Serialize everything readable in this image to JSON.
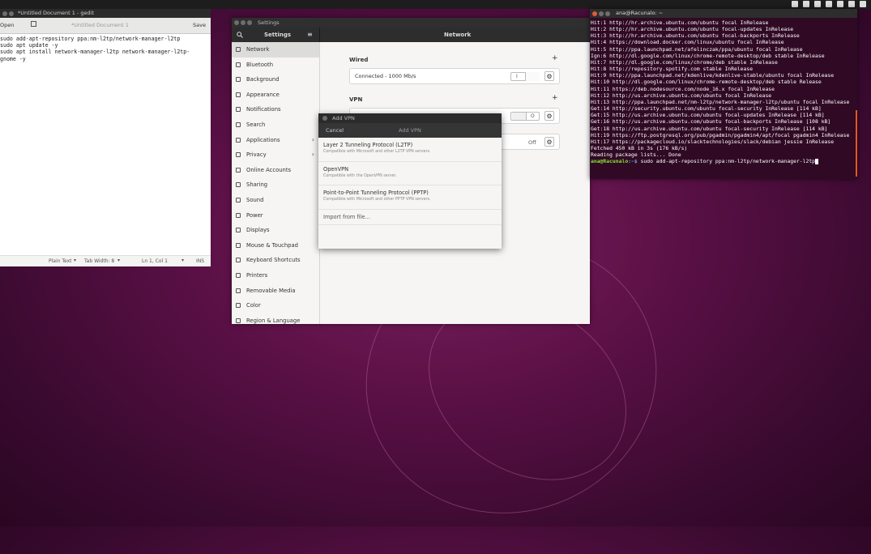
{
  "gedit": {
    "window_title": "*Untitled Document 1 - gedit",
    "open_label": "Open",
    "doc_title": "*Untitled Document 1",
    "save_label": "Save",
    "lines": [
      "sudo add-apt-repository ppa:nm-l2tp/network-manager-l2tp",
      "sudo apt update -y",
      "sudo apt install network-manager-l2tp network-manager-l2tp-",
      "gnome -y"
    ],
    "status": {
      "language": "Plain Text",
      "tab_width": "Tab Width: 8",
      "position": "Ln 1, Col 1",
      "mode": "INS"
    }
  },
  "settings": {
    "window_title": "Settings",
    "sidebar_title": "Settings",
    "panel_title": "Network",
    "sidebar_items": [
      {
        "label": "Network",
        "icon": "network-icon"
      },
      {
        "label": "Bluetooth",
        "icon": "bluetooth-icon"
      },
      {
        "label": "Background",
        "icon": "background-icon"
      },
      {
        "label": "Appearance",
        "icon": "appearance-icon"
      },
      {
        "label": "Notifications",
        "icon": "bell-icon"
      },
      {
        "label": "Search",
        "icon": "search-icon"
      },
      {
        "label": "Applications",
        "icon": "applications-icon"
      },
      {
        "label": "Privacy",
        "icon": "privacy-icon"
      },
      {
        "label": "Online Accounts",
        "icon": "online-accounts-icon"
      },
      {
        "label": "Sharing",
        "icon": "sharing-icon"
      },
      {
        "label": "Sound",
        "icon": "sound-icon"
      },
      {
        "label": "Power",
        "icon": "power-icon"
      },
      {
        "label": "Displays",
        "icon": "displays-icon"
      },
      {
        "label": "Mouse & Touchpad",
        "icon": "mouse-icon"
      },
      {
        "label": "Keyboard Shortcuts",
        "icon": "keyboard-icon"
      },
      {
        "label": "Printers",
        "icon": "printer-icon"
      },
      {
        "label": "Removable Media",
        "icon": "removable-media-icon"
      },
      {
        "label": "Color",
        "icon": "color-icon"
      },
      {
        "label": "Region & Language",
        "icon": "region-icon"
      }
    ],
    "wired": {
      "title": "Wired",
      "status": "Connected - 1000 Mb/s",
      "switch": "I"
    },
    "vpn": {
      "title": "VPN",
      "switch": "O"
    },
    "proxy": {
      "value": "Off"
    }
  },
  "addvpn": {
    "window_title": "Add VPN",
    "cancel_label": "Cancel",
    "header_title": "Add VPN",
    "options": [
      {
        "title": "Layer 2 Tunneling Protocol (L2TP)",
        "desc": "Compatible with Microsoft and other L2TP VPN servers."
      },
      {
        "title": "OpenVPN",
        "desc": "Compatible with the OpenVPN server."
      },
      {
        "title": "Point-to-Point Tunneling Protocol (PPTP)",
        "desc": "Compatible with Microsoft and other PPTP VPN servers."
      }
    ],
    "import_label": "Import from file…"
  },
  "terminal": {
    "window_title": "ana@Racunalo: ~",
    "lines": [
      "Hit:1 http://hr.archive.ubuntu.com/ubuntu focal InRelease",
      "Hit:2 http://hr.archive.ubuntu.com/ubuntu focal-updates InRelease",
      "Hit:3 http://hr.archive.ubuntu.com/ubuntu focal-backports InRelease",
      "Hit:4 https://download.docker.com/linux/ubuntu focal InRelease",
      "Hit:5 http://ppa.launchpad.net/afelinczak/ppa/ubuntu focal InRelease",
      "Ign:6 http://dl.google.com/linux/chrome-remote-desktop/deb stable InRelease",
      "Hit:7 http://dl.google.com/linux/chrome/deb stable InRelease",
      "Hit:8 http://repository.spotify.com stable InRelease",
      "Hit:9 http://ppa.launchpad.net/kdenlive/kdenlive-stable/ubuntu focal InRelease",
      "Hit:10 http://dl.google.com/linux/chrome-remote-desktop/deb stable Release",
      "Hit:11 https://deb.nodesource.com/node_16.x focal InRelease",
      "Hit:12 http://us.archive.ubuntu.com/ubuntu focal InRelease",
      "Hit:13 http://ppa.launchpad.net/nm-l2tp/network-manager-l2tp/ubuntu focal InRelease",
      "Get:14 http://security.ubuntu.com/ubuntu focal-security InRelease [114 kB]",
      "Get:15 http://us.archive.ubuntu.com/ubuntu focal-updates InRelease [114 kB]",
      "Get:16 http://us.archive.ubuntu.com/ubuntu focal-backports InRelease [108 kB]",
      "Get:18 http://us.archive.ubuntu.com/ubuntu focal-security InRelease [114 kB]",
      "Hit:19 https://ftp.postgresql.org/pub/pgadmin/pgadmin4/apt/focal pgadmin4 InRelease",
      "Hit:17 https://packagecloud.io/slacktechnologies/slack/debian jessie InRelease",
      "Fetched 450 kB in 3s (176 kB/s)",
      "Reading package lists... Done"
    ],
    "prompt_user": "ana@Racunalo",
    "prompt_path": ":~$ ",
    "command": "sudo add-apt-repository ppa:nm-l2tp/network-manager-l2tp"
  }
}
